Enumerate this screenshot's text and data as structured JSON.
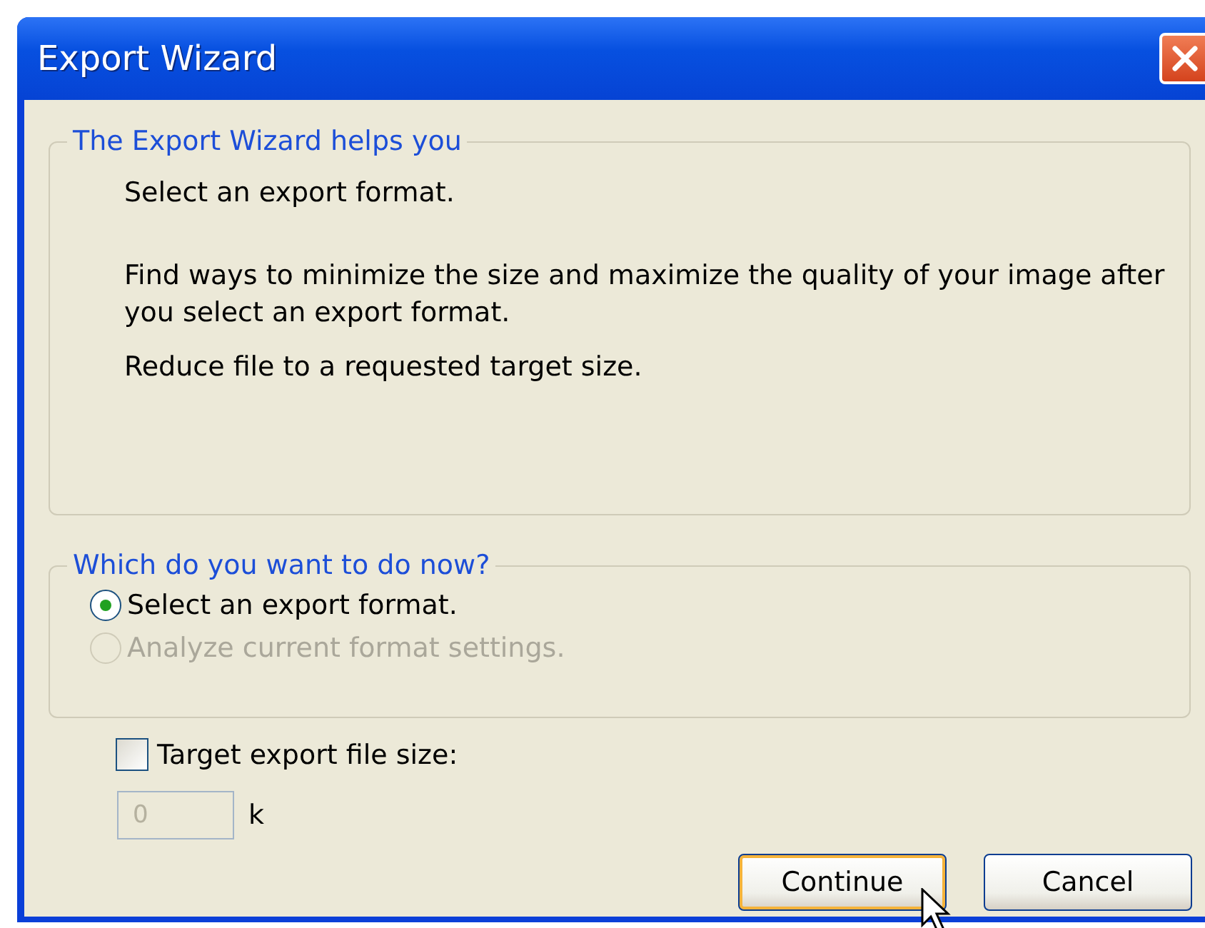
{
  "window": {
    "title": "Export Wizard"
  },
  "intro_group": {
    "legend": "The Export Wizard helps you",
    "paragraphs": [
      "Select an export format.",
      "Find ways to minimize the size and maximize the quality of your image after you select an export format.",
      "Reduce file to a requested target size."
    ]
  },
  "choice_group": {
    "legend": "Which do you want to do now?",
    "options": [
      {
        "label": "Select an export format.",
        "selected": true,
        "disabled": false
      },
      {
        "label": "Analyze current format settings.",
        "selected": false,
        "disabled": true
      }
    ]
  },
  "target_size": {
    "label": "Target export file size:",
    "checked": false,
    "value": "0",
    "disabled": true,
    "unit": "k"
  },
  "buttons": [
    {
      "label": "Continue",
      "default": true
    },
    {
      "label": "Cancel",
      "default": false
    }
  ]
}
